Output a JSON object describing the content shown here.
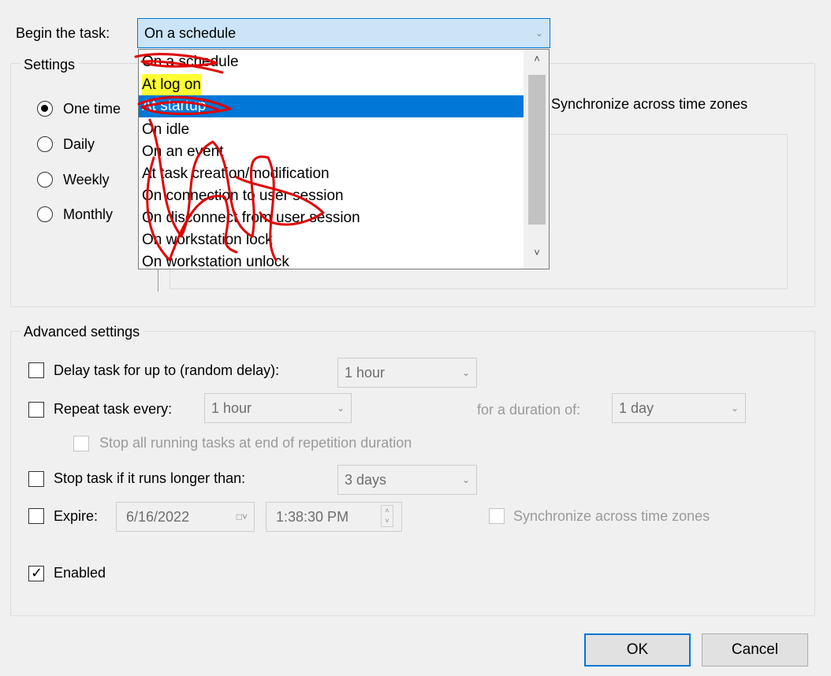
{
  "begin": {
    "label": "Begin the task:",
    "value": "On a schedule",
    "options": [
      {
        "label": "On a schedule",
        "selected": false,
        "highlighted": false
      },
      {
        "label": "At log on",
        "selected": false,
        "highlighted": true
      },
      {
        "label": "At startup",
        "selected": true,
        "highlighted": false
      },
      {
        "label": "On idle",
        "selected": false,
        "highlighted": false
      },
      {
        "label": "On an event",
        "selected": false,
        "highlighted": false
      },
      {
        "label": "At task creation/modification",
        "selected": false,
        "highlighted": false
      },
      {
        "label": "On connection to user session",
        "selected": false,
        "highlighted": false
      },
      {
        "label": "On disconnect from user session",
        "selected": false,
        "highlighted": false
      },
      {
        "label": "On workstation lock",
        "selected": false,
        "highlighted": false
      },
      {
        "label": "On workstation unlock",
        "selected": false,
        "highlighted": false
      }
    ]
  },
  "settings": {
    "title": "Settings",
    "radios": [
      {
        "label": "One time",
        "checked": true
      },
      {
        "label": "Daily",
        "checked": false
      },
      {
        "label": "Weekly",
        "checked": false
      },
      {
        "label": "Monthly",
        "checked": false
      }
    ],
    "sync_label": "Synchronize across time zones"
  },
  "advanced": {
    "title": "Advanced settings",
    "delay": {
      "label": "Delay task for up to (random delay):",
      "value": "1 hour",
      "checked": false
    },
    "repeat": {
      "label": "Repeat task every:",
      "value": "1 hour",
      "checked": false,
      "duration_label": "for a duration of:",
      "duration_value": "1 day"
    },
    "stop_all": {
      "label": "Stop all running tasks at end of repetition duration",
      "checked": false
    },
    "stop_longer": {
      "label": "Stop task if it runs longer than:",
      "value": "3 days",
      "checked": false
    },
    "expire": {
      "label": "Expire:",
      "date": "6/16/2022",
      "time": "1:38:30 PM",
      "checked": false,
      "sync_label": "Synchronize across time zones"
    },
    "enabled": {
      "label": "Enabled",
      "checked": true
    }
  },
  "buttons": {
    "ok": "OK",
    "cancel": "Cancel"
  },
  "colors": {
    "accent": "#0078d7",
    "highlight": "#ffff33",
    "annotation": "#e00000"
  }
}
